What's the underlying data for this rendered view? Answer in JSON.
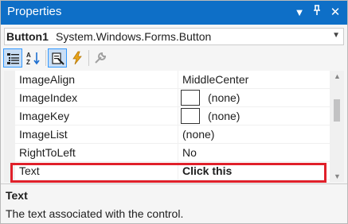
{
  "window": {
    "title": "Properties",
    "dropdown_glyph": "▼",
    "pin_glyph": "⊥",
    "close_glyph": "✕"
  },
  "object_selector": {
    "name": "Button1",
    "type": "System.Windows.Forms.Button"
  },
  "toolbar": {
    "tools": [
      {
        "icon": "categorized-icon",
        "active": true
      },
      {
        "icon": "alphabetical-icon",
        "active": false
      },
      {
        "icon": "properties-icon",
        "active": true
      },
      {
        "icon": "events-icon",
        "active": false
      },
      {
        "icon": "property-pages-icon",
        "active": false
      }
    ]
  },
  "grid": {
    "rows": [
      {
        "name": "ImageAlign",
        "value": "MiddleCenter",
        "swatch": false
      },
      {
        "name": "ImageIndex",
        "value": "(none)",
        "swatch": true
      },
      {
        "name": "ImageKey",
        "value": "(none)",
        "swatch": true
      },
      {
        "name": "ImageList",
        "value": "(none)",
        "swatch": false
      },
      {
        "name": "RightToLeft",
        "value": "No",
        "swatch": false
      },
      {
        "name": "Text",
        "value": "Click this",
        "swatch": false,
        "selected": true
      }
    ]
  },
  "description": {
    "title": "Text",
    "text": "The text associated with the control."
  },
  "colors": {
    "titlebar": "#0e6fc7",
    "highlight": "#e0202a"
  }
}
